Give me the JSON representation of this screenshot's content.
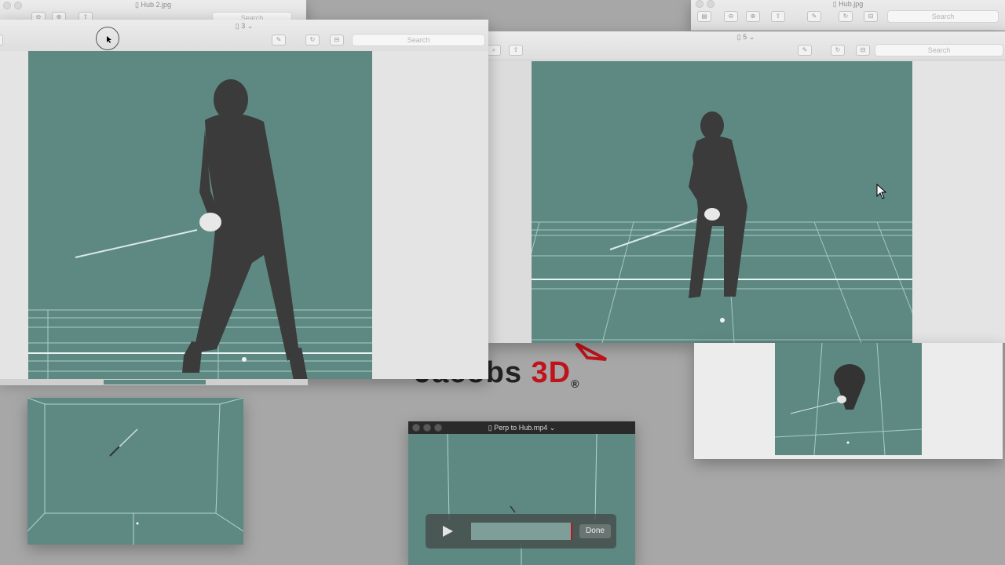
{
  "windows": {
    "hub2": {
      "title": "Hub 2.jpg",
      "search_placeholder": "Search"
    },
    "preview3": {
      "page_indicator": "3",
      "search_placeholder": "Search"
    },
    "hub": {
      "title": "Hub.jpg",
      "search_placeholder": "Search"
    },
    "preview5": {
      "page_indicator": "5",
      "search_placeholder": "Search"
    },
    "video": {
      "title": "Perp to Hub.mp4",
      "done_label": "Done"
    }
  },
  "logo": {
    "text_main": "Jacobs",
    "text_3d": "3D",
    "registered": "®"
  },
  "colors": {
    "teal_bg": "#5e8982",
    "body_dark": "#3a3a3a",
    "logo_red": "#c0141c"
  },
  "icons": [
    "search-icon",
    "zoom-out-icon",
    "zoom-in-icon",
    "share-icon",
    "markup-pen-icon",
    "rotate-icon",
    "toolbox-icon",
    "play-icon",
    "document-icon"
  ]
}
